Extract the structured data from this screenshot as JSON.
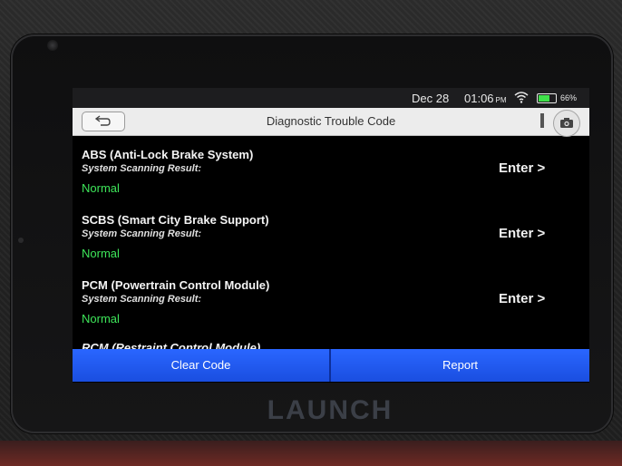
{
  "device": {
    "brand": "LAUNCH"
  },
  "status_bar": {
    "date": "Dec 28",
    "time": "01:06",
    "ampm": "PM",
    "battery": "66%",
    "battery_level": 0.66,
    "battery_color": "#3fe04a"
  },
  "header": {
    "title": "Diagnostic Trouble Code",
    "back_icon": "back-arrow-icon",
    "camera_icon": "camera-icon"
  },
  "systems": [
    {
      "name": "ABS (Anti-Lock Brake System)",
      "result_label": "System Scanning Result:",
      "status": "Normal",
      "action": "Enter >"
    },
    {
      "name": "SCBS (Smart City Brake Support)",
      "result_label": "System Scanning Result:",
      "status": "Normal",
      "action": "Enter >"
    },
    {
      "name": "PCM (Powertrain Control Module)",
      "result_label": "System Scanning Result:",
      "status": "Normal",
      "action": "Enter >"
    }
  ],
  "partial_system": {
    "name": "RCM (Restraint Control Module)"
  },
  "actions": {
    "clear_code": "Clear Code",
    "report": "Report"
  },
  "colors": {
    "status_normal": "#3ee65a",
    "action_bar": "#2a66ff"
  }
}
